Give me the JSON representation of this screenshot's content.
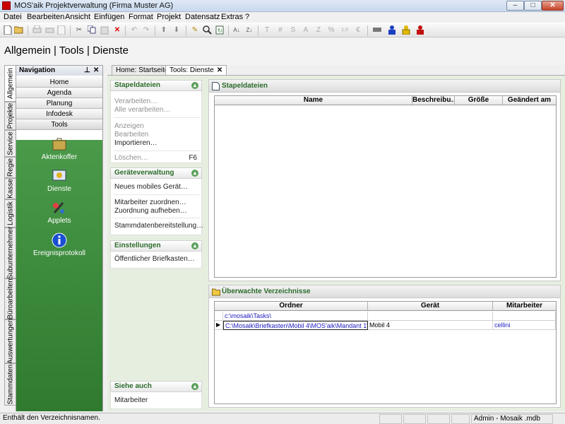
{
  "window": {
    "title": "MOS'aik Projektverwaltung (Firma Muster AG)",
    "min": "‒",
    "max": "□",
    "close": "✕"
  },
  "menu": [
    {
      "label": "Datei"
    },
    {
      "label": "Bearbeiten"
    },
    {
      "label": "Ansicht"
    },
    {
      "label": "Einfügen"
    },
    {
      "label": "Format"
    },
    {
      "label": "Projekt"
    },
    {
      "label": "Datensatz"
    },
    {
      "label": "Extras"
    },
    {
      "label": "?"
    }
  ],
  "toolbar": {
    "text_icons": {
      "bold": "T",
      "hash": "#",
      "s": "S",
      "a": "A",
      "z": "Z",
      "pct": "%",
      "num": "1,0"
    }
  },
  "header": {
    "title": "Allgemein | Tools | Dienste"
  },
  "vtabs": [
    "Allgemein",
    "Projekte",
    "Service",
    "Regie",
    "Kasse",
    "Logistik",
    "Subunternehmer",
    "Büroarbeiten",
    "Auswertungen",
    "Stammdaten"
  ],
  "navigation": {
    "title": "Navigation",
    "pin": "⊥",
    "close": "✕",
    "buttons": [
      "Home",
      "Agenda",
      "Planung",
      "Infodesk",
      "Tools"
    ],
    "tools": [
      "Aktenkoffer",
      "Dienste",
      "Applets",
      "Ereignisprotokoll"
    ]
  },
  "tabs": [
    {
      "label": "Home: Startseite"
    },
    {
      "label": "Tools: Dienste",
      "close": "✕"
    }
  ],
  "taskpane": {
    "stapel": {
      "title": "Stapeldateien",
      "items": [
        "Verarbeiten…",
        "Alle verarbeiten…",
        "Anzeigen",
        "Bearbeiten",
        "Importieren…",
        "Löschen…"
      ],
      "shortcut": "F6"
    },
    "geraete": {
      "title": "Geräteverwaltung",
      "items": [
        "Neues mobiles Gerät…",
        "Mitarbeiter zuordnen…",
        "Zuordnung aufheben…",
        "Stammdatenbereitstellung…"
      ]
    },
    "einstellungen": {
      "title": "Einstellungen",
      "items": [
        "Öffentlicher Briefkasten…"
      ]
    },
    "siehe": {
      "title": "Siehe auch",
      "items": [
        "Mitarbeiter"
      ]
    },
    "chev": "▴"
  },
  "stapel_panel": {
    "title": "Stapeldateien",
    "columns": [
      "Name",
      "Beschreibu…",
      "Größe",
      "Geändert am"
    ]
  },
  "ueberwacht_panel": {
    "title": "Überwachte Verzeichnisse",
    "columns": [
      "Ordner",
      "Gerät",
      "Mitarbeiter"
    ],
    "rows": [
      {
        "ordner": "c:\\mosaik\\Tasks\\",
        "geraet": "",
        "mitarbeiter": ""
      },
      {
        "ordner": "C:\\Mosaik\\Briefkasten\\Mobil 4\\MOS'aik\\Mandant 1\\...",
        "geraet": "Mobil 4",
        "mitarbeiter": "cellini"
      }
    ],
    "row_marker": "▶"
  },
  "status": {
    "message": "Enthält den Verzeichnisnamen.",
    "db": "Admin - Mosaik .mdb"
  },
  "colors": {
    "accent_green": "#2b6b2b",
    "nav_green": "#3f8b3f",
    "link_blue": "#2020c0"
  }
}
